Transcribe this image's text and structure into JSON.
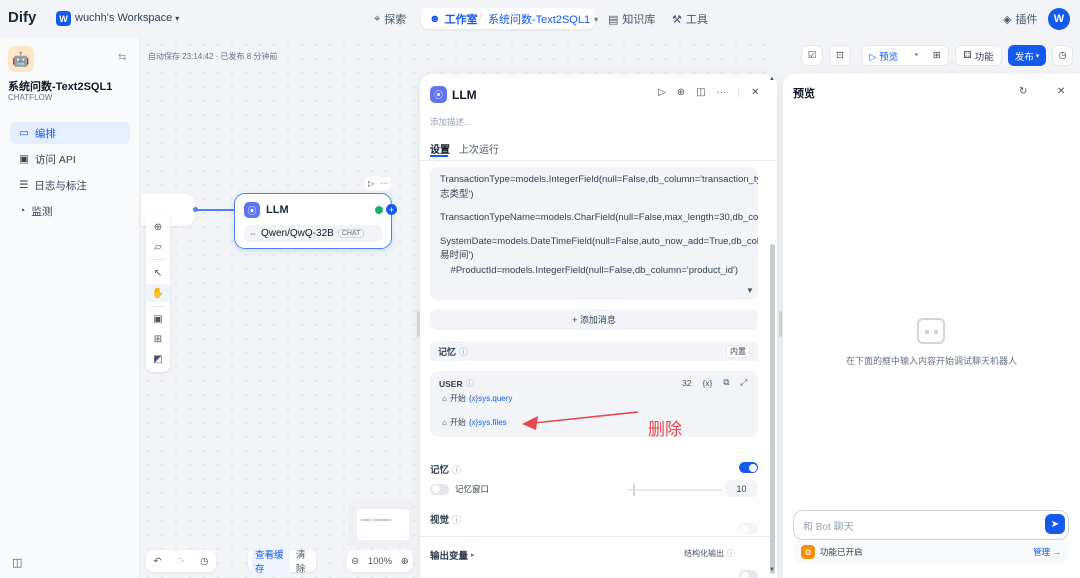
{
  "topbar": {
    "logo": "Dify",
    "workspace_badge": "W",
    "workspace_name": "wuchh's Workspace",
    "nav": {
      "explore": "探索",
      "studio": "工作室",
      "app_crumb": "系统问数-Text2SQL1",
      "knowledge": "知识库",
      "tools": "工具"
    },
    "plugins": "插件",
    "avatar": "W"
  },
  "sidebar": {
    "app_name": "系统问数-Text2SQL1",
    "app_type": "CHATFLOW",
    "items": [
      {
        "label": "编排",
        "icon": "layout-icon"
      },
      {
        "label": "访问 API",
        "icon": "terminal-icon"
      },
      {
        "label": "日志与标注",
        "icon": "file-list-icon"
      },
      {
        "label": "监测",
        "icon": "monitor-icon"
      }
    ]
  },
  "canvas": {
    "autosave": "自动保存 23:14:42 · 已发布 8 分钟前",
    "node": {
      "title": "LLM",
      "model": "Qwen/QwQ-32B",
      "model_tag": "CHAT"
    },
    "zoom": "100%",
    "view_cache": "查看缓存",
    "clear": "清除"
  },
  "toolbar": {
    "preview": "预览",
    "features": "功能",
    "publish": "发布"
  },
  "panel": {
    "title": "LLM",
    "desc_placeholder": "添加描述...",
    "tabs": [
      "设置",
      "上次运行"
    ],
    "prompt_lines": [
      "TransactionType=models.IntegerField(null=False,db_column='transaction_type',verbose_name=u'日志类型')",
      "TransactionTypeName=models.CharField(null=False,max_length=30,db_column='transaction_type_name',verbose_name='branch_id')",
      "SystemDate=models.DateTimeField(null=False,auto_now_add=True,db_column='system_date',verbose_name=u'交易时间')",
      "    #ProductId=models.IntegerField(null=False,db_column='product_id')"
    ],
    "add_message": "+ 添加消息",
    "memory_header": "记忆",
    "memory_builtin": "内置",
    "user_box": {
      "label": "USER",
      "count": "32",
      "var1_prefix": "开始",
      "var1": "{x}sys.query",
      "var2_prefix": "开始",
      "var2": "{x}sys.files"
    },
    "memory_label": "记忆",
    "memory_window": "记忆窗口",
    "memory_window_value": "10",
    "vision_label": "视觉",
    "output_vars": "输出变量",
    "structured_output": "结构化输出"
  },
  "annotation": "删除",
  "preview": {
    "title": "预览",
    "empty_hint": "在下面的框中输入内容开始调试聊天机器人",
    "input_placeholder": "和 Bot 聊天",
    "features_enabled": "功能已开启",
    "manage": "管理 →"
  },
  "colors": {
    "accent": "#155aef",
    "annotation": "#e5484d"
  }
}
